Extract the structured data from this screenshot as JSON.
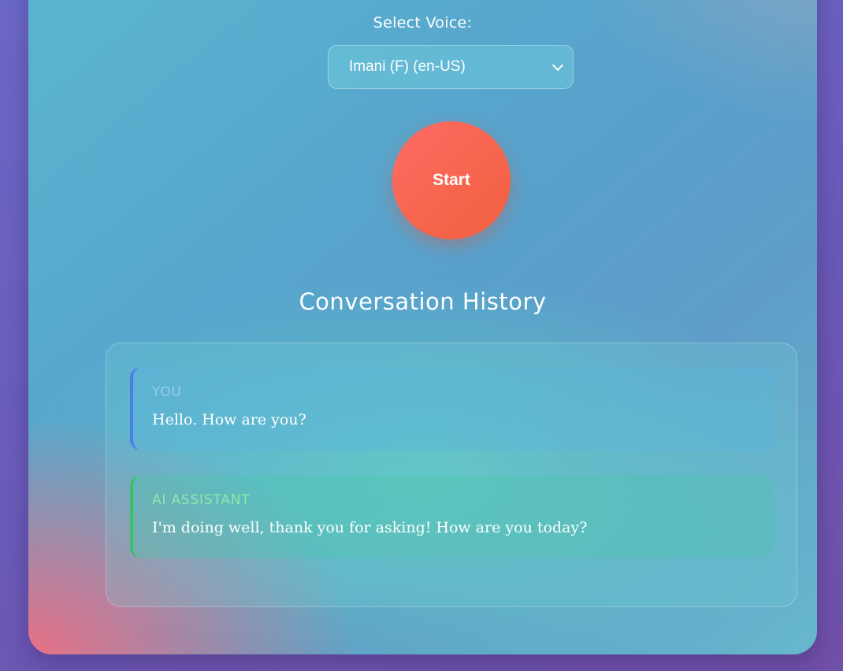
{
  "voice": {
    "label": "Select Voice:",
    "selected": "Imani (F) (en-US)"
  },
  "controls": {
    "start_label": "Start"
  },
  "history": {
    "title": "Conversation History",
    "messages": [
      {
        "role": "YOU",
        "text": "Hello. How are you?"
      },
      {
        "role": "AI ASSISTANT",
        "text": "I'm doing well, thank you for asking! How are you today?"
      }
    ]
  },
  "colors": {
    "start_button": "#f0603c",
    "user_accent": "#4a7fe8",
    "ai_accent": "#3cbf6a"
  },
  "icons": {
    "select_dropdown": "chevron-down-icon"
  }
}
